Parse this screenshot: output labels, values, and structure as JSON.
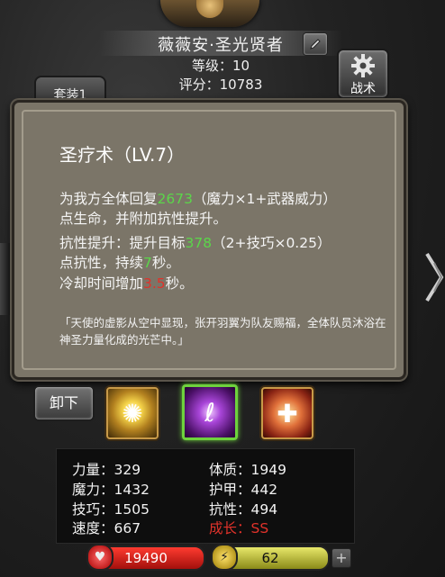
{
  "hero": {
    "name": "薇薇安·圣光贤者",
    "level_text": "等级：10",
    "score_text": "评分：10783"
  },
  "buttons": {
    "tactics": "战术",
    "suit_tab": "套装1",
    "unequip": "卸下"
  },
  "skill": {
    "title": "圣疗术（LV.7）",
    "line1_pre": "为我方全体回复",
    "line1_val": "2673",
    "line1_post": "（魔力×1+武器威力）",
    "line2": "点生命，并附加抗性提升。",
    "line3_pre": "抗性提升：提升目标",
    "line3_val": "378",
    "line3_post": "（2+技巧×0.25）",
    "line4_pre": "点抗性，持续",
    "line4_val": "7",
    "line4_post": "秒。",
    "line5_pre": "冷却时间增加",
    "line5_val": "3.5",
    "line5_post": "秒。",
    "flavor": "「天使的虚影从空中显现，张开羽翼为队友赐福，全体队员沐浴在神圣力量化成的光芒中。」"
  },
  "skill_slots": [
    {
      "icon": "sun-burst-icon"
    },
    {
      "icon": "holy-heal-icon",
      "selected": true
    },
    {
      "icon": "angel-shield-icon"
    }
  ],
  "stats": {
    "strength": "力量：329",
    "magic": "魔力：1432",
    "skill": "技巧：1505",
    "speed": "速度：667",
    "constitution": "体质：1949",
    "armor": "护甲：442",
    "resistance": "抗性：494",
    "growth": "成长：SS"
  },
  "bars": {
    "hp": "19490",
    "energy": "62"
  },
  "colors": {
    "highlight_green": "#5bd64a",
    "highlight_red": "#e0322a",
    "tooltip_bg": "#7b7568"
  }
}
